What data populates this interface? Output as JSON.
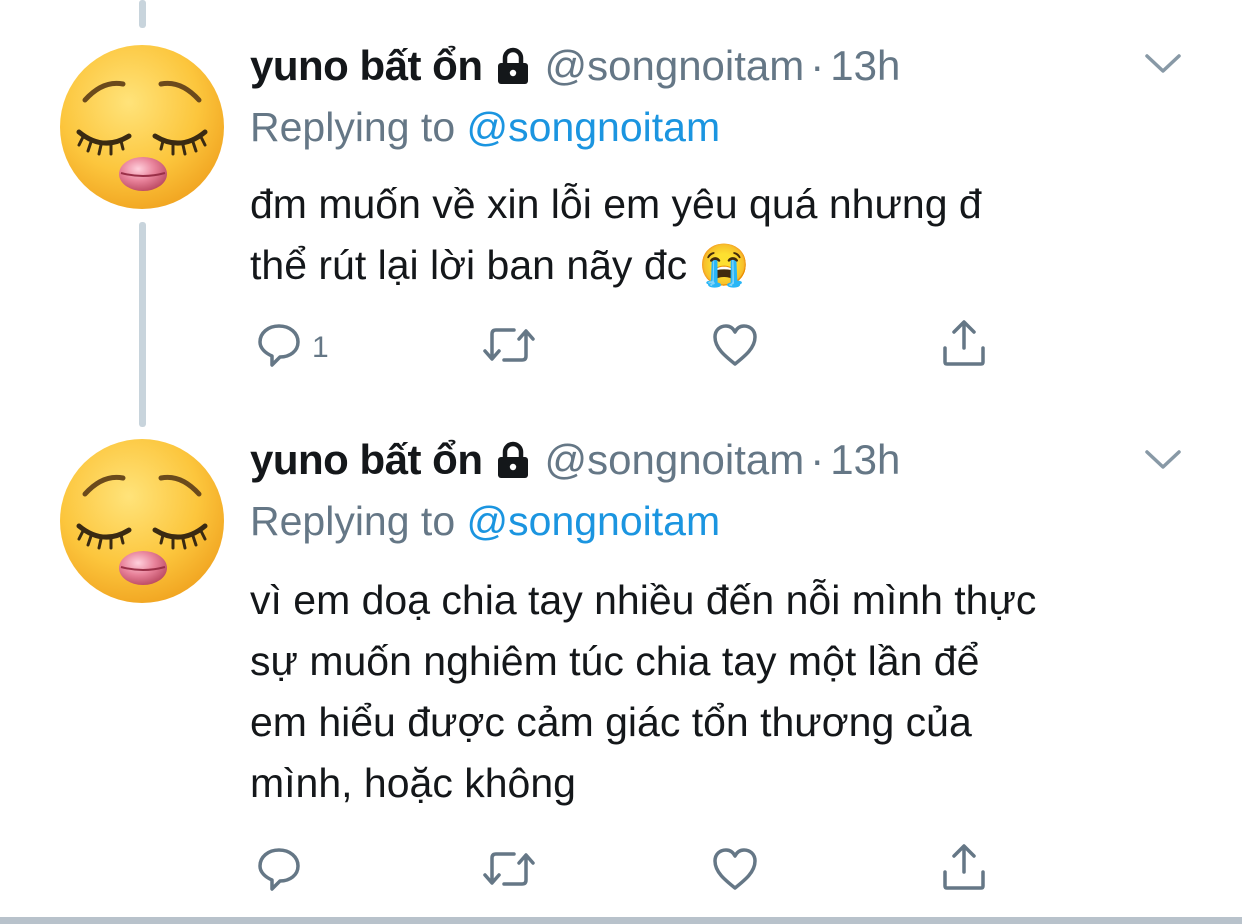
{
  "colors": {
    "text_primary": "#14171a",
    "text_secondary": "#657786",
    "link": "#1b95e0",
    "thread_line": "#c8d4dc"
  },
  "tweets": [
    {
      "display_name": "yuno bất ổn",
      "handle": "@songnoitam",
      "separator": "·",
      "time": "13h",
      "replying_prefix": "Replying to",
      "replying_to": "@songnoitam",
      "lines": [
        "đm muốn về xin lỗi em yêu quá nhưng đ",
        "thể rút lại lời ban nãy đc 😭"
      ],
      "reply_count": "1",
      "icons": [
        "reply-icon",
        "retweet-icon",
        "like-icon",
        "share-icon"
      ]
    },
    {
      "display_name": "yuno bất ổn",
      "handle": "@songnoitam",
      "separator": "·",
      "time": "13h",
      "replying_prefix": "Replying to",
      "replying_to": "@songnoitam",
      "lines": [
        "vì em doạ chia tay nhiều đến nỗi mình thực",
        "sự muốn nghiêm túc chia tay một lần để",
        "em hiểu được cảm giác tổn thương của",
        "mình, hoặc không"
      ],
      "reply_count": "",
      "icons": [
        "reply-icon",
        "retweet-icon",
        "like-icon",
        "share-icon"
      ]
    }
  ]
}
